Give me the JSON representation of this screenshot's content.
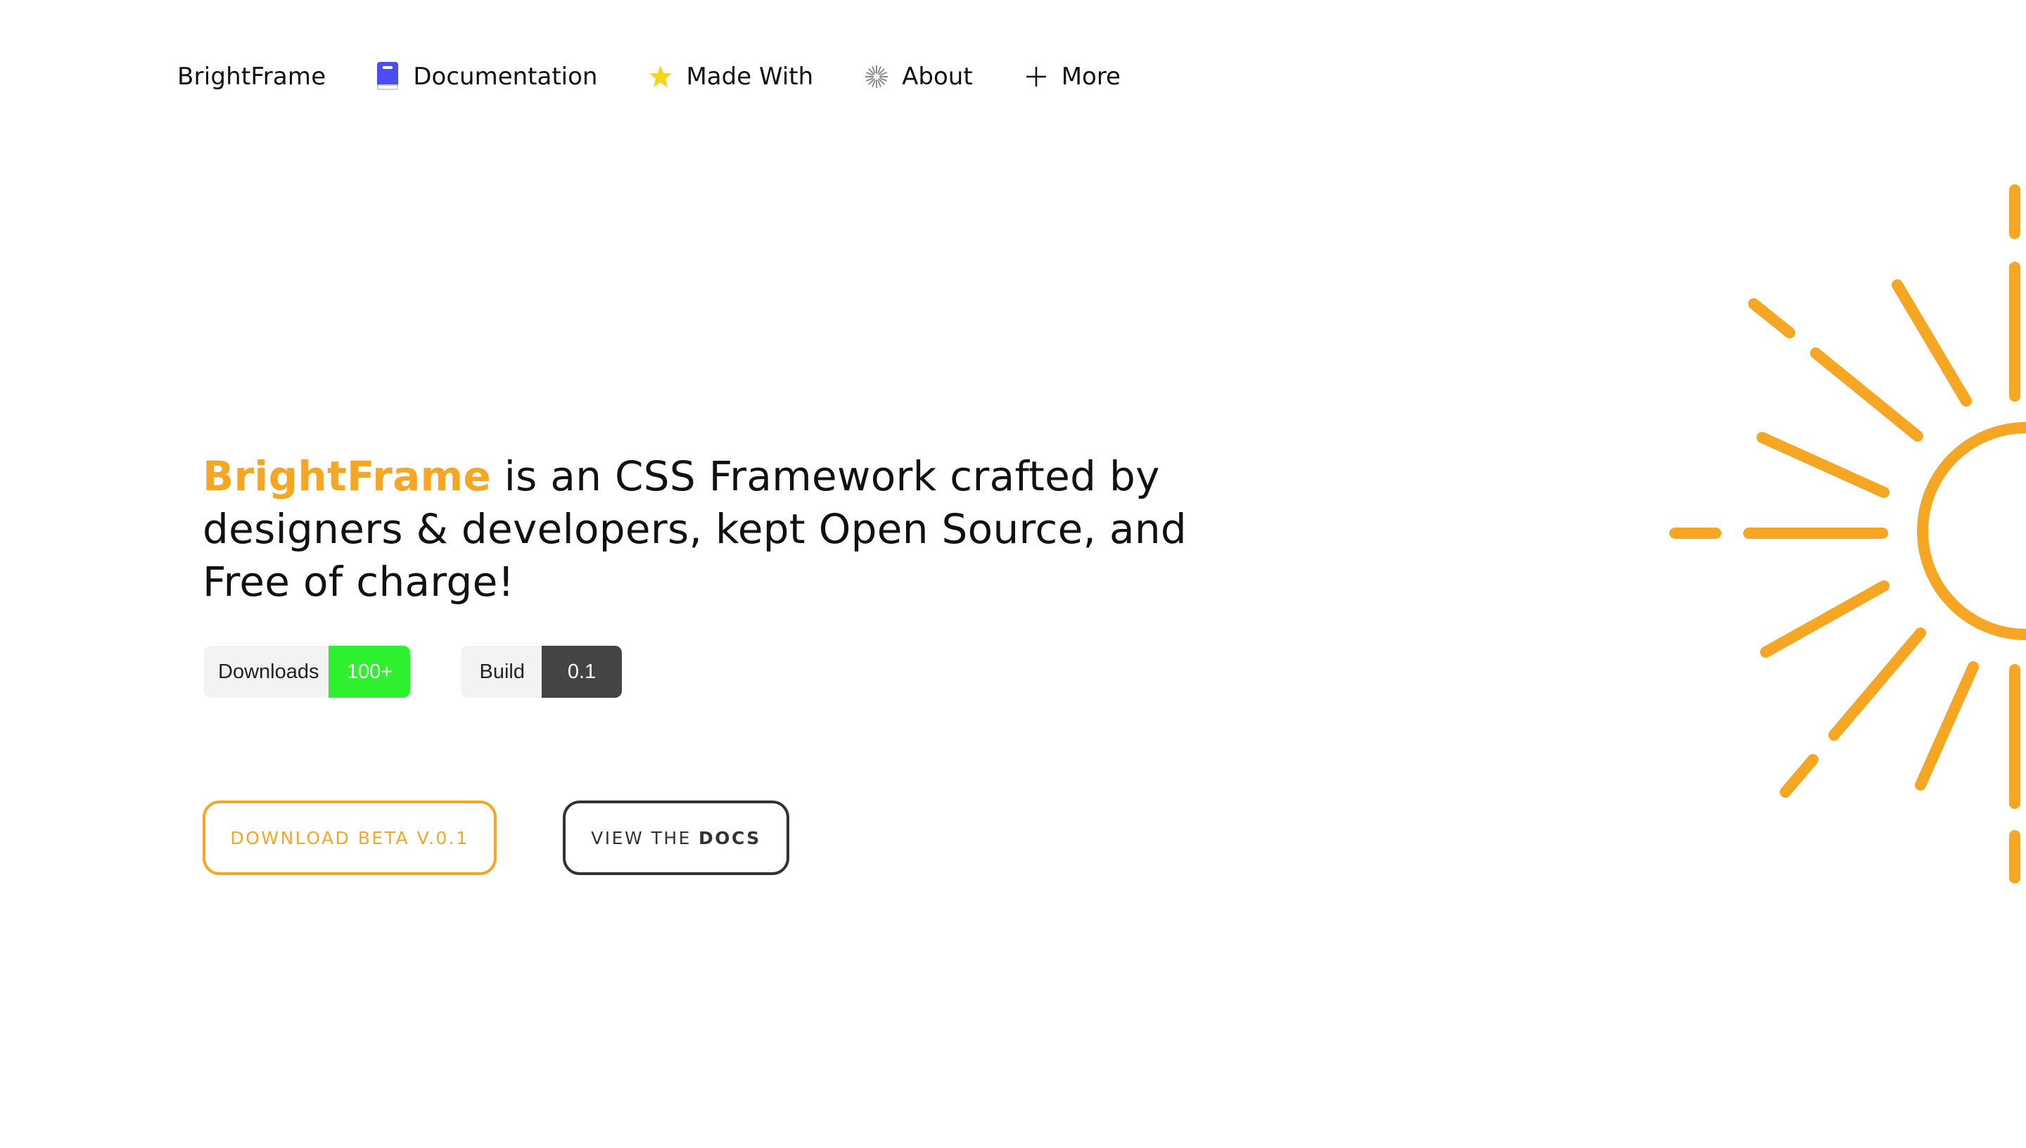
{
  "nav": {
    "brand": "BrightFrame",
    "items": [
      {
        "label": "Documentation",
        "icon": "book-icon"
      },
      {
        "label": "Made With",
        "icon": "star-icon"
      },
      {
        "label": "About",
        "icon": "burst-icon"
      },
      {
        "label": "More",
        "icon": "plus-icon"
      }
    ]
  },
  "hero": {
    "brand": "BrightFrame",
    "tagline": " is an CSS Framework crafted by designers & developers, kept Open Source, and Free of charge!"
  },
  "badges": {
    "downloads": {
      "label": "Downloads",
      "value": "100+"
    },
    "build": {
      "label": "Build",
      "value": "0.1"
    }
  },
  "buttons": {
    "download": "Download Beta v.0.1",
    "docs_prefix": "View the",
    "docs_strong": "Docs"
  },
  "colors": {
    "accent": "#f5a623",
    "downloads_badge": "#2ef02e",
    "build_badge": "#444444",
    "book_icon": "#4a4df0",
    "star_icon": "#f7d51d"
  }
}
